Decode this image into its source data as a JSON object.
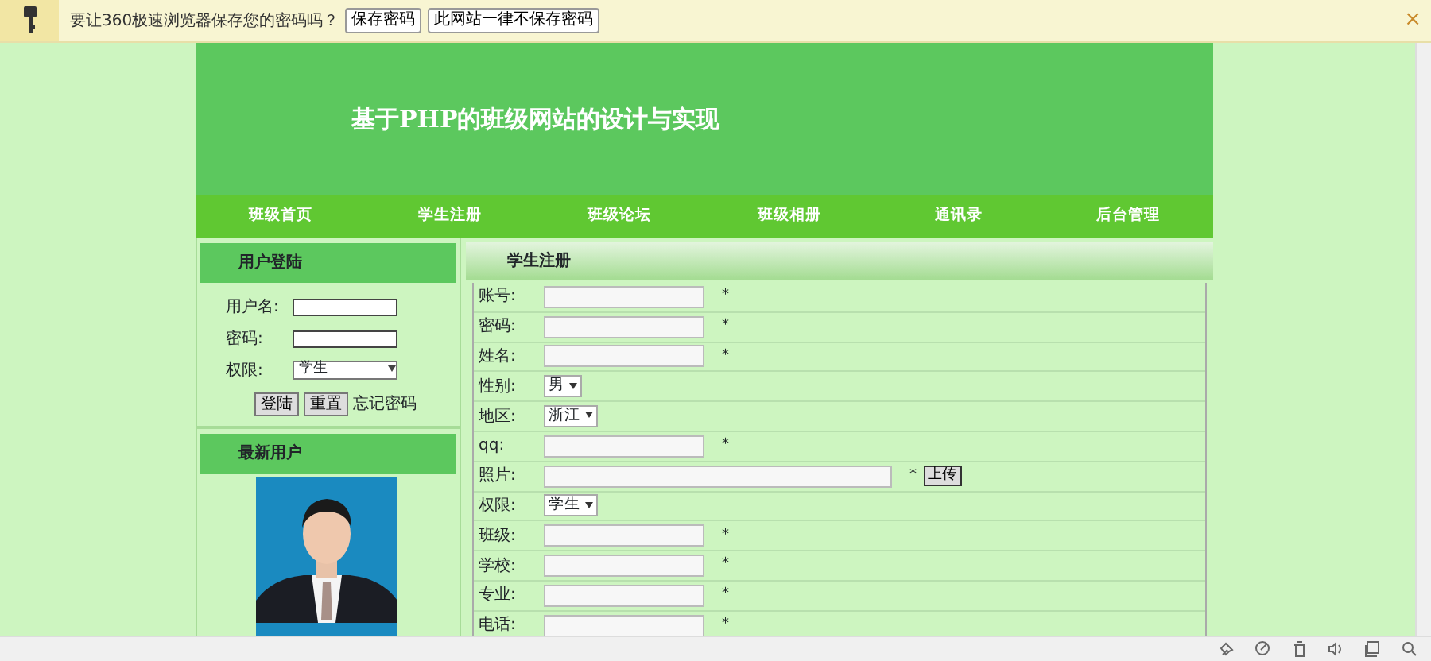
{
  "infobar": {
    "message": "要让360极速浏览器保存您的密码吗？",
    "buttons": [
      "保存密码",
      "此网站一律不保存密码"
    ],
    "close": "×"
  },
  "header": {
    "title": "基于PHP的班级网站的设计与实现"
  },
  "nav": [
    {
      "label": "班级首页"
    },
    {
      "label": "学生注册"
    },
    {
      "label": "班级论坛"
    },
    {
      "label": "班级相册"
    },
    {
      "label": "通讯录"
    },
    {
      "label": "后台管理"
    }
  ],
  "login": {
    "title": "用户登陆",
    "fields": [
      {
        "kind": "input",
        "label": "用户名:"
      },
      {
        "kind": "input",
        "label": "密码:"
      },
      {
        "kind": "select",
        "label": "权限:",
        "value": "学生"
      }
    ],
    "buttons": [
      "登陆",
      "重置"
    ],
    "link": "忘记密码"
  },
  "latest_users": {
    "title": "最新用户"
  },
  "register": {
    "title": "学生注册",
    "rows": [
      {
        "label": "账号:",
        "kind": "input",
        "mark": "*"
      },
      {
        "label": "密码:",
        "kind": "input",
        "mark": "*"
      },
      {
        "label": "姓名:",
        "kind": "input",
        "mark": "*"
      },
      {
        "label": "性别:",
        "kind": "select",
        "value": "男"
      },
      {
        "label": "地区:",
        "kind": "select",
        "value": "浙江"
      },
      {
        "label": "qq:",
        "kind": "input",
        "mark": "*"
      },
      {
        "label": "照片:",
        "kind": "upload",
        "mark": "*",
        "button": "上传"
      },
      {
        "label": "权限:",
        "kind": "select",
        "value": "学生"
      },
      {
        "label": "班级:",
        "kind": "input",
        "mark": "*"
      },
      {
        "label": "学校:",
        "kind": "input",
        "mark": "*"
      },
      {
        "label": "专业:",
        "kind": "input",
        "mark": "*"
      },
      {
        "label": "电话:",
        "kind": "input",
        "mark": "*"
      }
    ]
  }
}
